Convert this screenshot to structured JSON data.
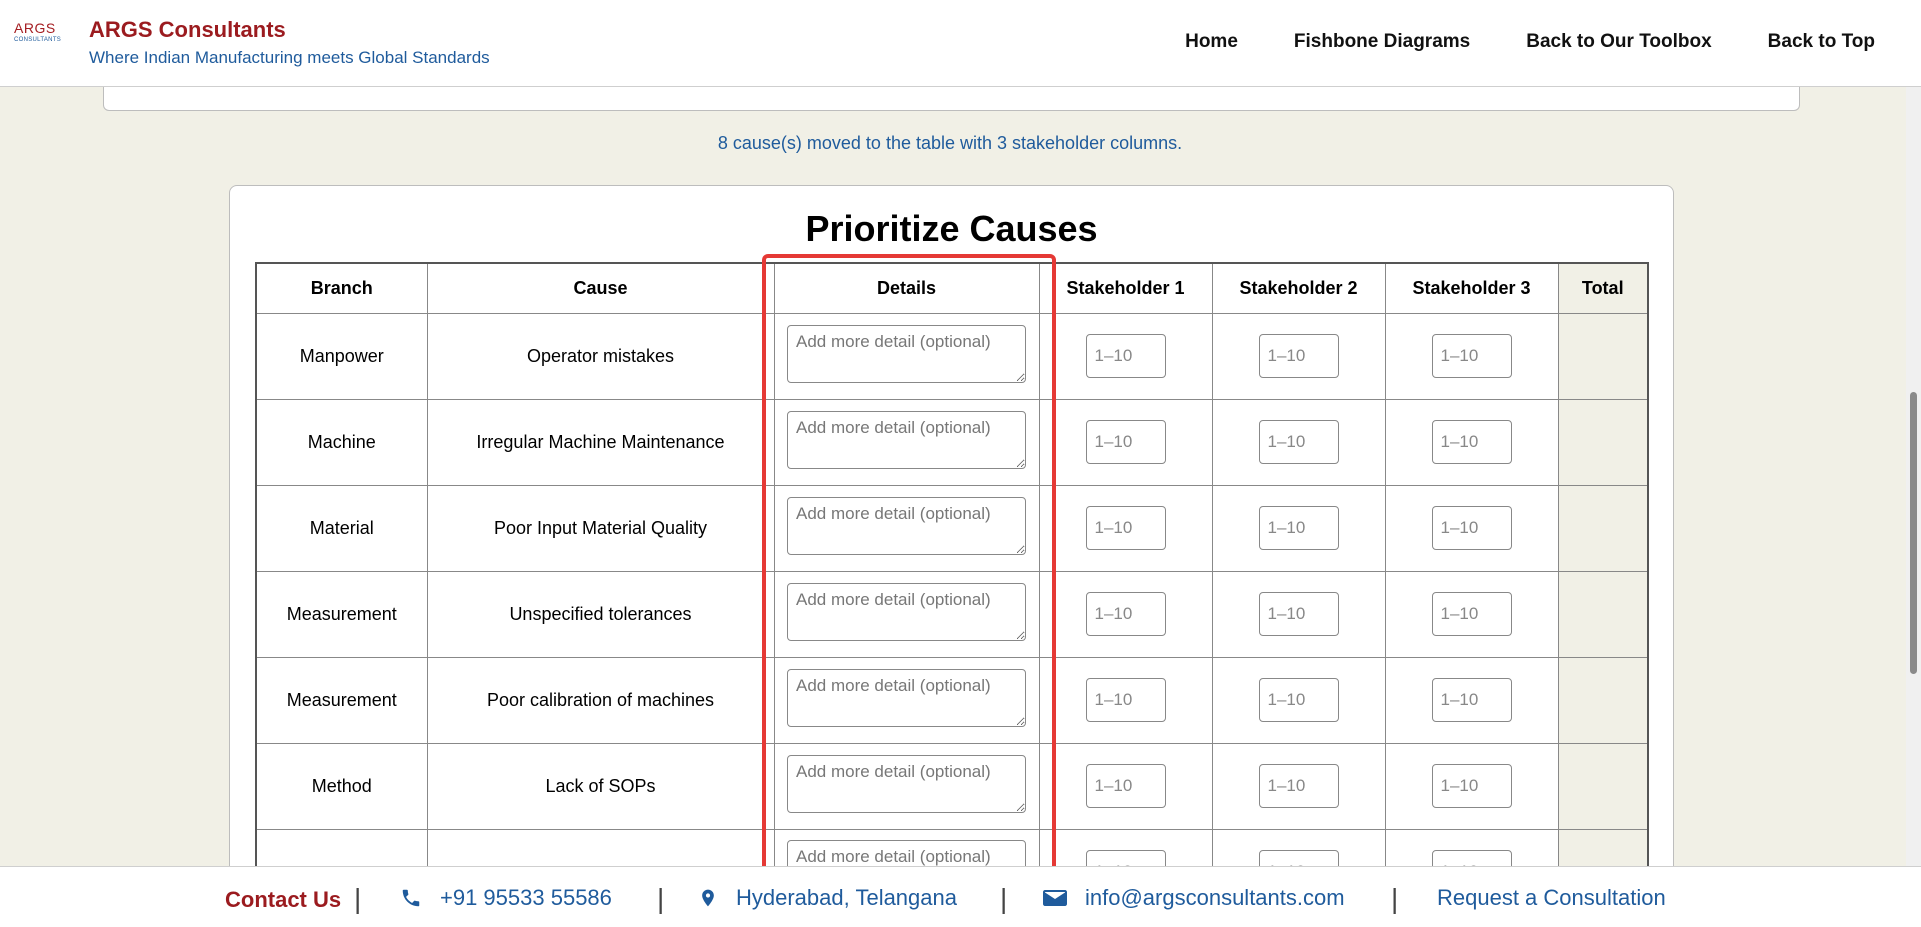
{
  "header": {
    "logo_main": "ARGS",
    "logo_sub": "CONSULTANTS",
    "title": "ARGS Consultants",
    "tagline": "Where Indian Manufacturing meets Global Standards",
    "nav": [
      "Home",
      "Fishbone Diagrams",
      "Back to Our Toolbox",
      "Back to Top"
    ]
  },
  "status_message": "8 cause(s) moved to the table with 3 stakeholder columns.",
  "prioritize": {
    "title": "Prioritize Causes",
    "columns": [
      "Branch",
      "Cause",
      "Details",
      "Stakeholder 1",
      "Stakeholder 2",
      "Stakeholder 3",
      "Total"
    ],
    "detail_placeholder": "Add more detail (optional)",
    "score_placeholder": "1–10",
    "rows": [
      {
        "branch": "Manpower",
        "cause": "Operator mistakes"
      },
      {
        "branch": "Machine",
        "cause": "Irregular Machine Maintenance"
      },
      {
        "branch": "Material",
        "cause": "Poor Input Material Quality"
      },
      {
        "branch": "Measurement",
        "cause": "Unspecified tolerances"
      },
      {
        "branch": "Measurement",
        "cause": "Poor calibration of machines"
      },
      {
        "branch": "Method",
        "cause": "Lack of SOPs"
      },
      {
        "branch": "",
        "cause": ""
      }
    ]
  },
  "footer": {
    "contact_title": "Contact Us",
    "phone": "+91 95533 55586",
    "location": "Hyderabad, Telangana",
    "email": "info@argsconsultants.com",
    "consult": "Request a Consultation"
  },
  "colors": {
    "brand_red": "#9b1b1f",
    "brand_blue": "#1f5b9c",
    "highlight": "#e53935",
    "page_bg": "#f1f0e6"
  }
}
